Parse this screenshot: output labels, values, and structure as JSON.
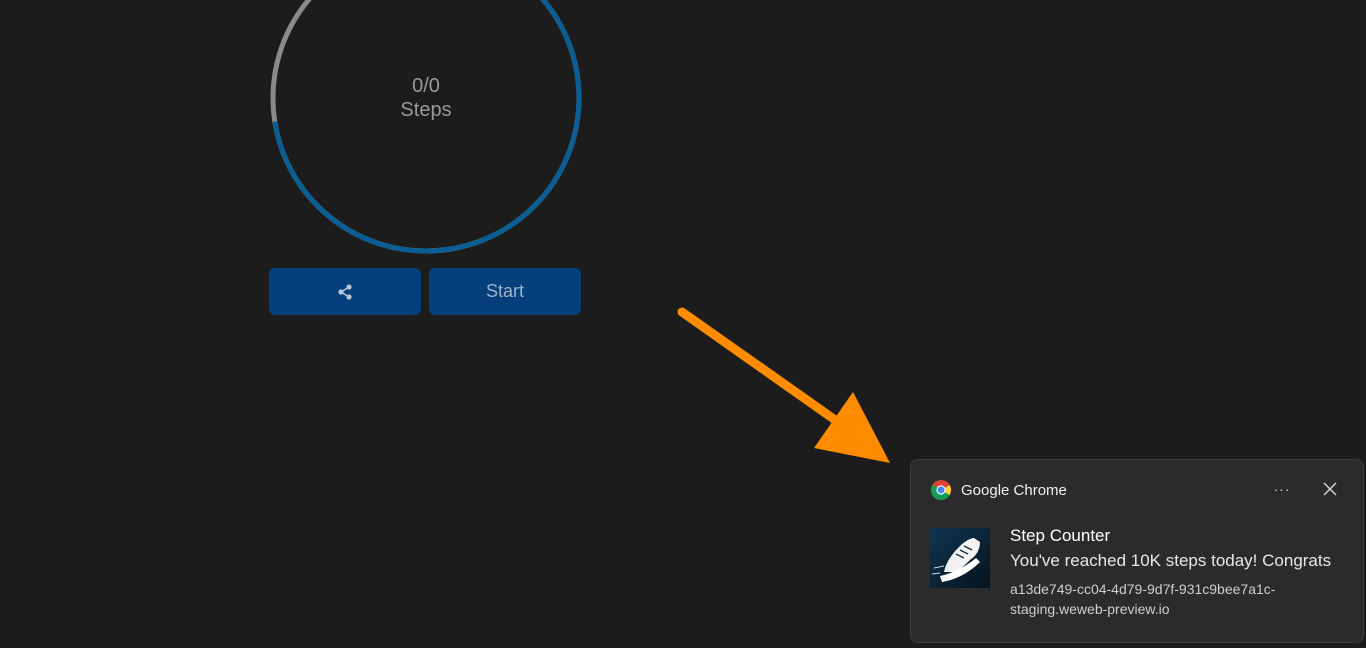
{
  "step_counter": {
    "count_text": "0/0",
    "unit_label": "Steps",
    "progress_fraction": 0.82,
    "colors": {
      "track": "#8a8a8a",
      "progress": "#0a5e93",
      "button": "#053f7c"
    }
  },
  "buttons": {
    "share_icon": "share-icon",
    "start_label": "Start"
  },
  "annotation": {
    "arrow_color": "#ff8c00"
  },
  "notification": {
    "app_name": "Google Chrome",
    "more_icon": "···",
    "title": "Step Counter",
    "message": "You've reached 10K steps today! Congrats",
    "source_line1": "a13de749-cc04-4d79-9d7f-931c9bee7a1c-",
    "source_line2": "staging.weweb-preview.io"
  }
}
